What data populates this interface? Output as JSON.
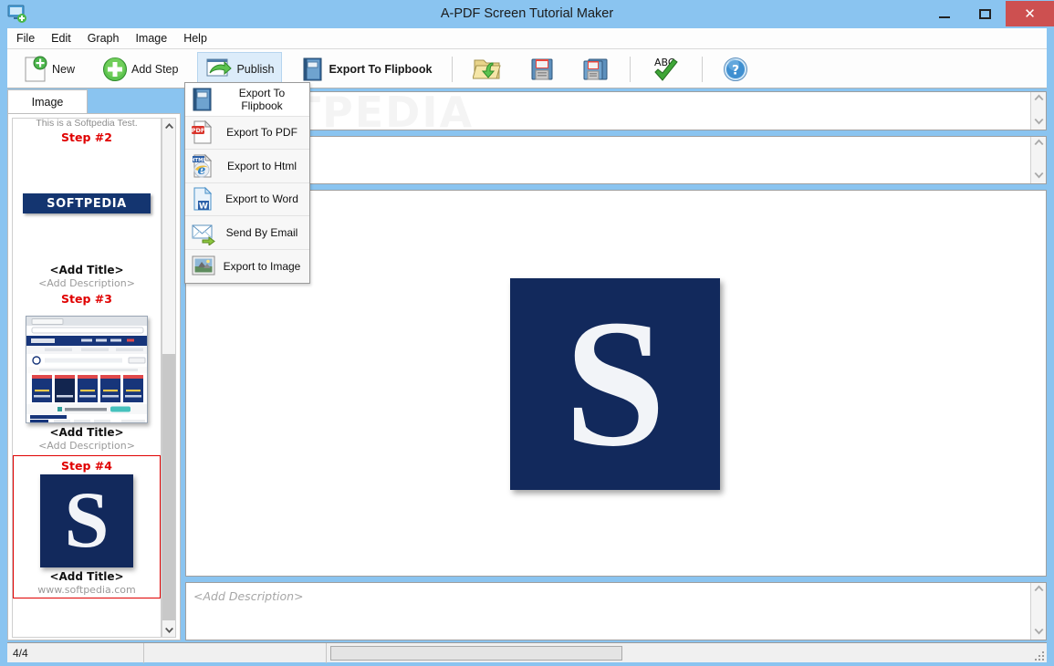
{
  "window": {
    "title": "A-PDF Screen Tutorial Maker",
    "icon": "screen-add-icon",
    "minimize_label": "–",
    "maximize_label": "□",
    "close_label": "✕",
    "titlebar_color": "#8ac4f0",
    "close_color": "#cd5050"
  },
  "menubar": {
    "items": [
      {
        "label": "File"
      },
      {
        "label": "Edit"
      },
      {
        "label": "Graph"
      },
      {
        "label": "Image"
      },
      {
        "label": "Help"
      }
    ]
  },
  "toolbar": {
    "buttons": [
      {
        "label": "New",
        "icon": "new-document-icon"
      },
      {
        "label": "Add Step",
        "icon": "add-plus-icon"
      },
      {
        "label": "Publish",
        "icon": "publish-arrow-icon",
        "active": true
      },
      {
        "label": "Export To Flipbook",
        "icon": "book-icon"
      }
    ],
    "icon_buttons": [
      {
        "label": "",
        "icon": "open-folder-icon"
      },
      {
        "label": "",
        "icon": "save-icon"
      },
      {
        "label": "",
        "icon": "save-as-icon"
      },
      {
        "label": "",
        "icon": "spellcheck-abc-icon"
      },
      {
        "label": "",
        "icon": "help-question-icon"
      }
    ]
  },
  "publish_menu": {
    "open": true,
    "items": [
      {
        "label": "Export To Flipbook",
        "icon": "book-icon",
        "highlighted": true
      },
      {
        "label": "Export To PDF",
        "icon": "pdf-icon"
      },
      {
        "label": "Export to Html",
        "icon": "html-browser-icon"
      },
      {
        "label": "Export to Word",
        "icon": "word-doc-icon"
      },
      {
        "label": "Send By Email",
        "icon": "email-send-icon"
      },
      {
        "label": "Export to Image",
        "icon": "image-picture-icon"
      }
    ]
  },
  "sidebar": {
    "tab_label": "Image",
    "steps": [
      {
        "top_text": "This is a Softpedia Test.",
        "step_label": "Step #2",
        "thumb": "softpedia-logo",
        "logo_text": "SOFTPEDIA",
        "title": "<Add Title>",
        "description": "<Add Description>",
        "selected": false
      },
      {
        "step_label": "Step #3",
        "thumb": "browser-screenshot",
        "title": "<Add Title>",
        "description": "<Add Description>",
        "selected": false
      },
      {
        "step_label": "Step #4",
        "thumb": "s-logo",
        "logo_text": "S",
        "title": "<Add Title>",
        "description": "www.softpedia.com",
        "selected": true
      }
    ],
    "step_label_color": "#e00000",
    "selection_color": "#e00000"
  },
  "editor": {
    "title_field_value": "",
    "title_field_placeholder": "",
    "notes_field_value": "",
    "notes_field_placeholder": "",
    "preview_image": "s-logo-large",
    "preview_glyph": "S",
    "preview_bg": "#12295c",
    "description_placeholder": "<Add Description>",
    "scroll_up": "⌃",
    "scroll_down": "⌄"
  },
  "statusbar": {
    "page_counter": "4/4",
    "progress_value": ""
  }
}
